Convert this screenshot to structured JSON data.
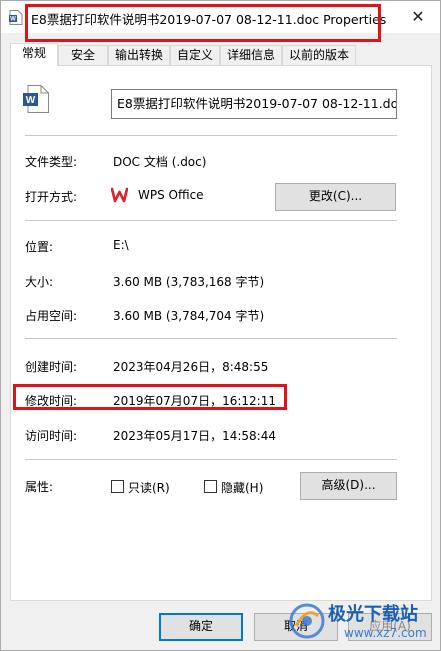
{
  "window": {
    "title": "E8票据打印软件说明书2019-07-07 08-12-11.doc Properties",
    "close_glyph": "✕"
  },
  "tabs": [
    {
      "label": "常规",
      "active": true
    },
    {
      "label": "安全",
      "active": false
    },
    {
      "label": "输出转换",
      "active": false
    },
    {
      "label": "自定义",
      "active": false
    },
    {
      "label": "详细信息",
      "active": false
    },
    {
      "label": "以前的版本",
      "active": false
    }
  ],
  "general": {
    "file_name": "E8票据打印软件说明书2019-07-07 08-12-11.doc",
    "file_type_label": "文件类型:",
    "file_type_value": "DOC 文档 (.doc)",
    "opens_with_label": "打开方式:",
    "opens_with_value": "WPS Office",
    "change_button": "更改(C)...",
    "location_label": "位置:",
    "location_value": "E:\\",
    "size_label": "大小:",
    "size_value": "3.60 MB (3,783,168 字节)",
    "size_on_disk_label": "占用空间:",
    "size_on_disk_value": "3.60 MB (3,784,704 字节)",
    "created_label": "创建时间:",
    "created_value": "2023年04月26日，8:48:55",
    "modified_label": "修改时间:",
    "modified_value": "2019年07月07日，16:12:11",
    "accessed_label": "访问时间:",
    "accessed_value": "2023年05月17日，14:58:44",
    "attributes_label": "属性:",
    "readonly_label": "只读(R)",
    "hidden_label": "隐藏(H)",
    "advanced_button": "高级(D)..."
  },
  "footer": {
    "ok_button": "确定",
    "cancel_button": "取消",
    "apply_button": "应用(A)"
  },
  "watermark": {
    "title": "极光下载站",
    "url": "www.xz7.com"
  },
  "colors": {
    "highlight": "#e0131b",
    "wps_red": "#d9232d",
    "word_blue": "#2b5797",
    "button_focus": "#0078d7"
  },
  "icons": {
    "title": "word-doc-icon",
    "file": "word-doc-icon",
    "app": "wps-office-icon",
    "watermark": "aurora-logo-icon"
  }
}
